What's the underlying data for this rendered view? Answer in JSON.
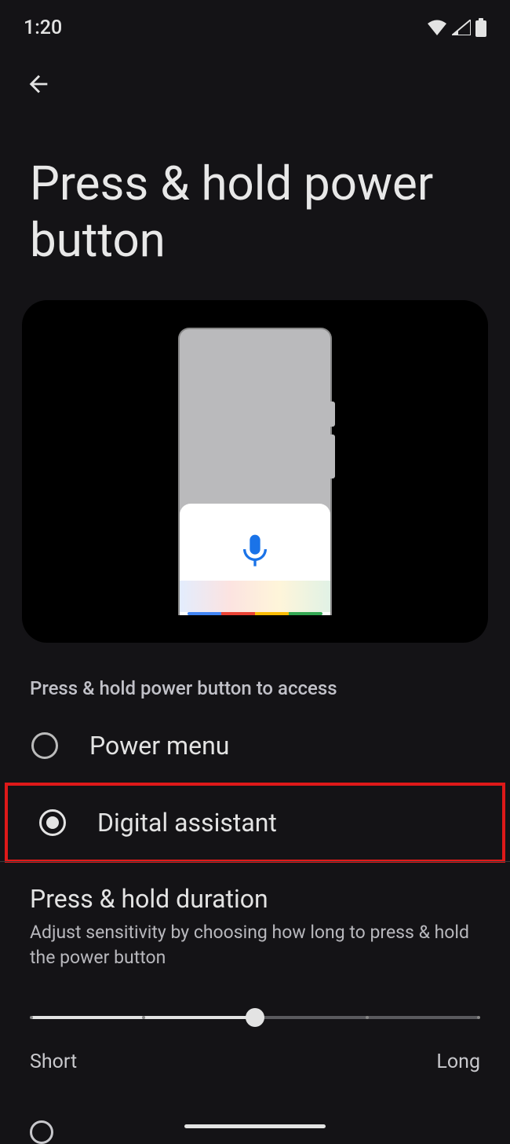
{
  "status": {
    "time": "1:20"
  },
  "page": {
    "title": "Press & hold power button"
  },
  "section": {
    "label": "Press & hold power button to access"
  },
  "options": [
    {
      "label": "Power menu",
      "selected": false
    },
    {
      "label": "Digital assistant",
      "selected": true,
      "highlighted": true
    }
  ],
  "duration": {
    "title": "Press & hold duration",
    "description": "Adjust sensitivity by choosing how long to press & hold the power button",
    "min_label": "Short",
    "max_label": "Long",
    "value": 2,
    "max": 4
  }
}
